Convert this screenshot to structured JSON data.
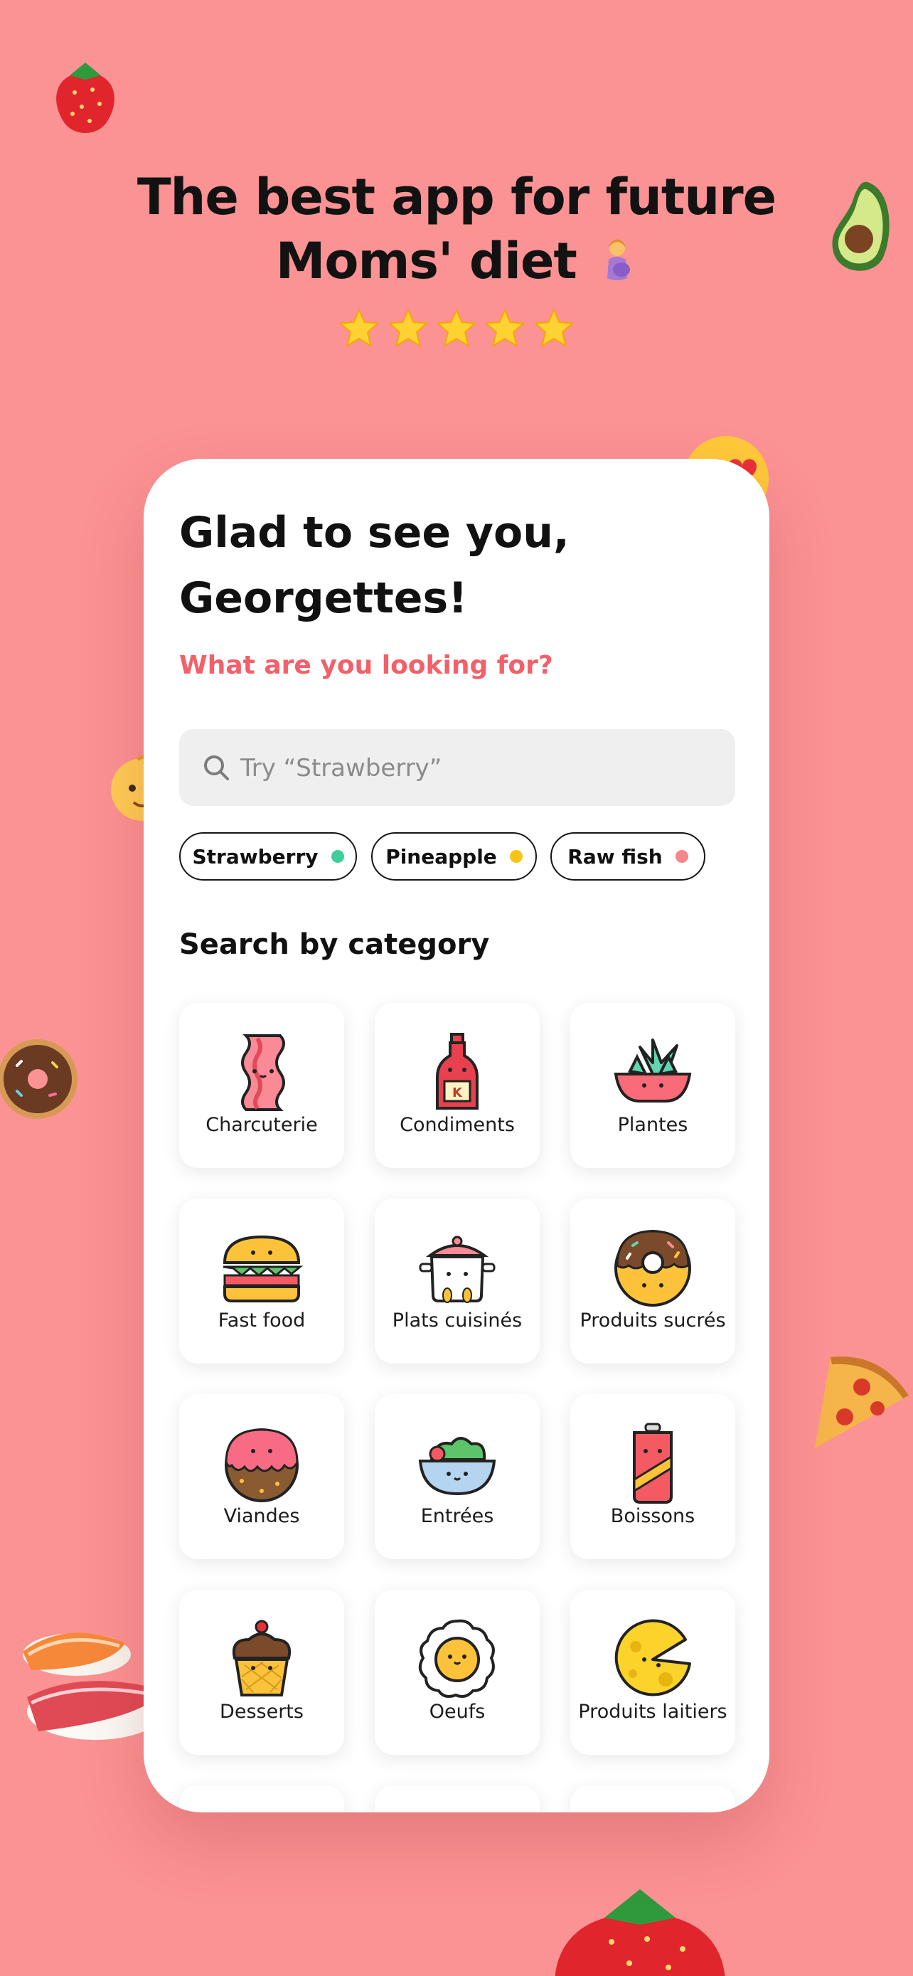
{
  "promo": {
    "headline_line1": "The best app for future",
    "headline_line2": "Moms' diet",
    "rating_stars": 5
  },
  "app": {
    "greeting_line1": "Glad to see you,",
    "greeting_line2": "Georgettes!",
    "question": "What are you looking for?",
    "search": {
      "placeholder": "Try “Strawberry”",
      "value": ""
    },
    "chips": [
      {
        "label": "Strawberry",
        "dot_color": "#3ccf9a"
      },
      {
        "label": "Pineapple",
        "dot_color": "#f7c515"
      },
      {
        "label": "Raw fish",
        "dot_color": "#f7868c"
      }
    ],
    "section_title": "Search by category",
    "categories": [
      {
        "label": "Charcuterie",
        "icon": "bacon-icon"
      },
      {
        "label": "Condiments",
        "icon": "ketchup-icon"
      },
      {
        "label": "Plantes",
        "icon": "plant-icon"
      },
      {
        "label": "Fast food",
        "icon": "burger-icon"
      },
      {
        "label": "Plats cuisinés",
        "icon": "cooking-pot-icon"
      },
      {
        "label": "Produits sucrés",
        "icon": "donut-icon"
      },
      {
        "label": "Viandes",
        "icon": "meatball-icon"
      },
      {
        "label": "Entrées",
        "icon": "salad-bowl-icon"
      },
      {
        "label": "Boissons",
        "icon": "soda-can-icon"
      },
      {
        "label": "Desserts",
        "icon": "cupcake-icon"
      },
      {
        "label": "Oeufs",
        "icon": "fried-egg-icon"
      },
      {
        "label": "Produits laitiers",
        "icon": "cheese-icon"
      }
    ]
  },
  "colors": {
    "background": "#fb9293",
    "accent": "#f3606a",
    "card": "#ffffff",
    "search_bg": "#efefef"
  }
}
